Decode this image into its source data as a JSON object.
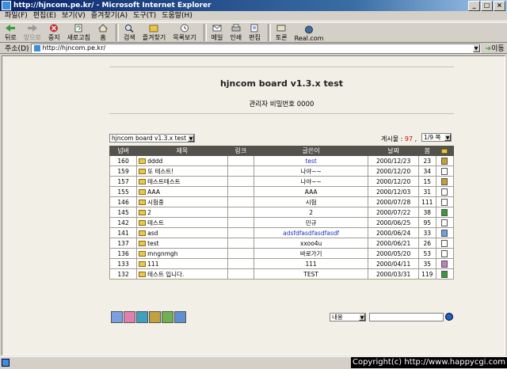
{
  "window": {
    "title": "http://hjncom.pe.kr/ - Microsoft Internet Explorer"
  },
  "menu": [
    "파일(F)",
    "편집(E)",
    "보기(V)",
    "즐겨찾기(A)",
    "도구(T)",
    "도움말(H)"
  ],
  "toolbar": {
    "back": "뒤로",
    "forward": "앞으로",
    "stop": "중지",
    "refresh": "새로고침",
    "home": "홈",
    "search": "검색",
    "favorites": "즐겨찾기",
    "history": "목록보기",
    "mail": "메일",
    "print": "인쇄",
    "edit": "편집",
    "discuss": "토론",
    "realcom": "Real.com"
  },
  "address": {
    "label": "주소(D)",
    "url": "http://hjncom.pe.kr/",
    "go": "이동"
  },
  "board": {
    "title": "hjncom board v1.3.x test",
    "admin_password": "관리자 비밀번호 0000",
    "board_select": "hjncom board v1.3.x test",
    "post_count_label": "게시물 : ",
    "post_count": "97",
    "post_count_suffix": " ,",
    "page_select": "1/9 쪽",
    "columns": {
      "num": "넘버",
      "subject": "제목",
      "link": "링크",
      "author": "글쓴이",
      "date": "날짜",
      "views": "봄"
    },
    "rows": [
      {
        "num": "160",
        "subject": "dddd",
        "author": "test",
        "date": "2000/12/23",
        "views": "23"
      },
      {
        "num": "159",
        "subject": "또 테스트!",
        "author": "나야~~",
        "date": "2000/12/20",
        "views": "34"
      },
      {
        "num": "157",
        "subject": "테스트테스트",
        "author": "나야~~",
        "date": "2000/12/20",
        "views": "15"
      },
      {
        "num": "155",
        "subject": "AAA",
        "author": "AAA",
        "date": "2000/12/03",
        "views": "31"
      },
      {
        "num": "146",
        "subject": "시험중",
        "author": "시험",
        "date": "2000/07/28",
        "views": "111"
      },
      {
        "num": "145",
        "subject": "2",
        "author": "2",
        "date": "2000/07/22",
        "views": "38"
      },
      {
        "num": "142",
        "subject": "테스트",
        "author": "민규",
        "date": "2000/06/25",
        "views": "95"
      },
      {
        "num": "141",
        "subject": "asd",
        "author": "adsfdfasdfasdfasdf",
        "date": "2000/06/24",
        "views": "33"
      },
      {
        "num": "137",
        "subject": "test",
        "author": "xxoo4u",
        "date": "2000/06/21",
        "views": "26"
      },
      {
        "num": "136",
        "subject": "mngnmgh",
        "author": "바로가기",
        "date": "2000/05/20",
        "views": "53"
      },
      {
        "num": "133",
        "subject": "111",
        "author": "111",
        "date": "2000/04/11",
        "views": "35"
      },
      {
        "num": "132",
        "subject": "테스트 입니다.",
        "author": "TEST",
        "date": "2000/03/31",
        "views": "119"
      }
    ],
    "search_select": "내용"
  },
  "status": {
    "copyright": "Copyright(c) http://www.happycgi.com"
  },
  "colors": {
    "header_bg": "#54524c",
    "link_blue": "#2030c0",
    "count_red": "#d00000"
  }
}
